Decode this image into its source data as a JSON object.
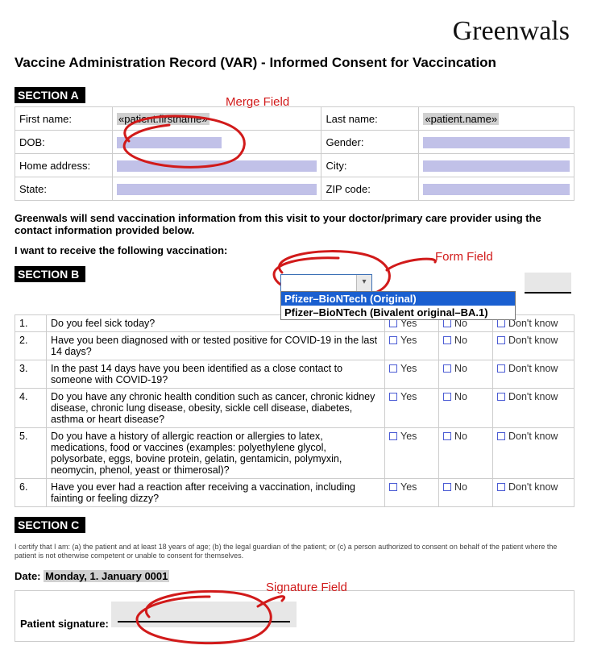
{
  "brand": "Greenwals",
  "title": "Vaccine Administration Record (VAR) - Informed Consent for Vaccincation",
  "sectionA": {
    "header": "SECTION A",
    "rows": [
      {
        "label1": "First name:",
        "value1_merge": "«patient.firstname»",
        "label2": "Last name:",
        "value2_merge": "«patient.name»"
      },
      {
        "label1": "DOB:",
        "value1_merge": "",
        "label2": "Gender:",
        "value2_merge": ""
      },
      {
        "label1": "Home address:",
        "value1_merge": "",
        "label2": "City:",
        "value2_merge": ""
      },
      {
        "label1": "State:",
        "value1_merge": "",
        "label2": "ZIP code:",
        "value2_merge": ""
      }
    ]
  },
  "infoParagraph": "Greenwals will send vaccination information from this visit to your doctor/primary care provider using the contact information provided below.",
  "chooseLabel": "I want to receive the following vaccination:",
  "dropdown": {
    "value": "",
    "options": [
      "Pfizer–BioNTech (Original)",
      "Pfizer–BioNTech (Bivalent original–BA.1)"
    ],
    "selectedIndex": 0
  },
  "sectionB": {
    "header": "SECTION B",
    "answerLabels": {
      "yes": "Yes",
      "no": "No",
      "dk": "Don't know"
    },
    "questions": [
      {
        "n": "1.",
        "text": "Do you feel sick today?"
      },
      {
        "n": "2.",
        "text": "Have you been diagnosed with or tested positive for COVID-19 in the last 14 days?"
      },
      {
        "n": "3.",
        "text": "In the past 14 days have you been identified as a close contact to someone with COVID-19?"
      },
      {
        "n": "4.",
        "text": "Do you have any chronic health condition such as cancer, chronic kidney disease, chronic lung disease, obesity, sickle cell disease, diabetes, asthma or heart disease?"
      },
      {
        "n": "5.",
        "text": "Do you have a history of allergic reaction or allergies to latex, medications, food or vaccines (examples: polyethylene glycol, polysorbate, eggs, bovine protein, gelatin, gentamicin, polymyxin, neomycin, phenol, yeast or thimerosal)?"
      },
      {
        "n": "6.",
        "text": "Have you ever had a reaction after receiving a vaccination, including fainting or feeling dizzy?"
      }
    ]
  },
  "sectionC": {
    "header": "SECTION C",
    "certText": "I certify that I am: (a) the patient and at least 18 years of age; (b) the legal guardian of the patient; or (c) a person authorized to consent on behalf of the patient where the patient is not otherwise competent or unable to consent for themselves.",
    "dateLabel": "Date:",
    "dateValue": "Monday, 1. January 0001",
    "sigLabel": "Patient signature:"
  },
  "annotations": {
    "mergeField": "Merge Field",
    "formField": "Form Field",
    "signatureField": "Signature Field"
  }
}
